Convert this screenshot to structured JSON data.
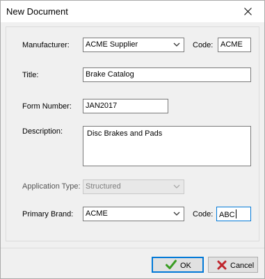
{
  "window": {
    "title": "New Document",
    "close_icon": "close-icon"
  },
  "form": {
    "manufacturer": {
      "label": "Manufacturer:",
      "value": "ACME Supplier",
      "code_label": "Code:",
      "code_value": "ACME"
    },
    "title": {
      "label": "Title:",
      "value": "Brake Catalog"
    },
    "form_number": {
      "label": "Form Number:",
      "value": "JAN2017"
    },
    "description": {
      "label": "Description:",
      "value": "Disc Brakes and Pads"
    },
    "application_type": {
      "label": "Application Type:",
      "value": "Structured",
      "enabled": false
    },
    "primary_brand": {
      "label": "Primary Brand:",
      "value": "ACME",
      "code_label": "Code:",
      "code_value": "ABC"
    }
  },
  "buttons": {
    "ok_label": "OK",
    "ok_icon": "checkmark-icon",
    "ok_color": "#3a9d23",
    "cancel_label": "Cancel",
    "cancel_icon": "x-icon",
    "cancel_color": "#c0262d"
  }
}
